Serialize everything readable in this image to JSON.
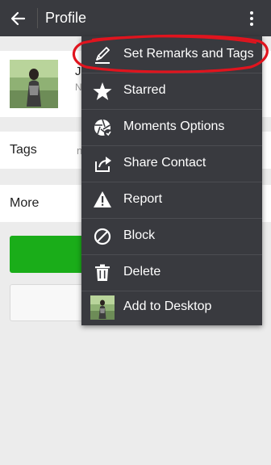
{
  "header": {
    "title": "Profile"
  },
  "profile": {
    "name_fragment": "J",
    "sub_fragment": "N"
  },
  "rows": {
    "tags_label": "Tags",
    "tags_value_fragment": "n",
    "more_label": "More"
  },
  "menu": {
    "items": [
      {
        "label": "Set Remarks and Tags",
        "icon": "pencil-icon"
      },
      {
        "label": "Starred",
        "icon": "star-icon"
      },
      {
        "label": "Moments Options",
        "icon": "moments-shutter-icon"
      },
      {
        "label": "Share Contact",
        "icon": "share-icon"
      },
      {
        "label": "Report",
        "icon": "warning-icon"
      },
      {
        "label": "Block",
        "icon": "block-icon"
      },
      {
        "label": "Delete",
        "icon": "trash-icon"
      },
      {
        "label": "Add to Desktop",
        "icon": "avatar-thumbnail"
      }
    ]
  },
  "colors": {
    "titlebar": "#393a3f",
    "menu_background": "#393a3f",
    "primary_button": "#1aad19",
    "annotation_circle": "#e0141e"
  }
}
